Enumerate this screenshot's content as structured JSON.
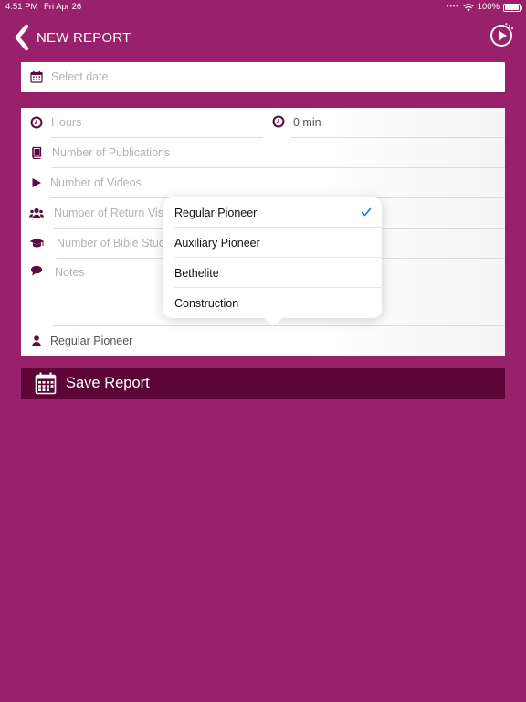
{
  "status_bar": {
    "time": "4:51 PM",
    "date": "Fri Apr 26",
    "battery": "100%"
  },
  "nav": {
    "title": "NEW REPORT"
  },
  "date_field": {
    "placeholder": "Select date"
  },
  "form": {
    "hours_placeholder": "Hours",
    "minutes_value": "0 min",
    "publications_placeholder": "Number of Publications",
    "videos_placeholder": "Number of Videos",
    "return_visits_placeholder": "Number of Return Visits",
    "bible_studies_placeholder": "Number of Bible Studies",
    "notes_placeholder": "Notes",
    "pioneer_type_value": "Regular Pioneer"
  },
  "save_button": {
    "label": "Save Report"
  },
  "dropdown": {
    "options": [
      {
        "label": "Regular Pioneer",
        "selected": true
      },
      {
        "label": "Auxiliary Pioneer",
        "selected": false
      },
      {
        "label": "Bethelite",
        "selected": false
      },
      {
        "label": "Construction",
        "selected": false
      }
    ]
  },
  "colors": {
    "background": "#99206b",
    "save_bar": "#5c0638",
    "icon": "#5a0d3c",
    "check": "#1a7bd8"
  }
}
